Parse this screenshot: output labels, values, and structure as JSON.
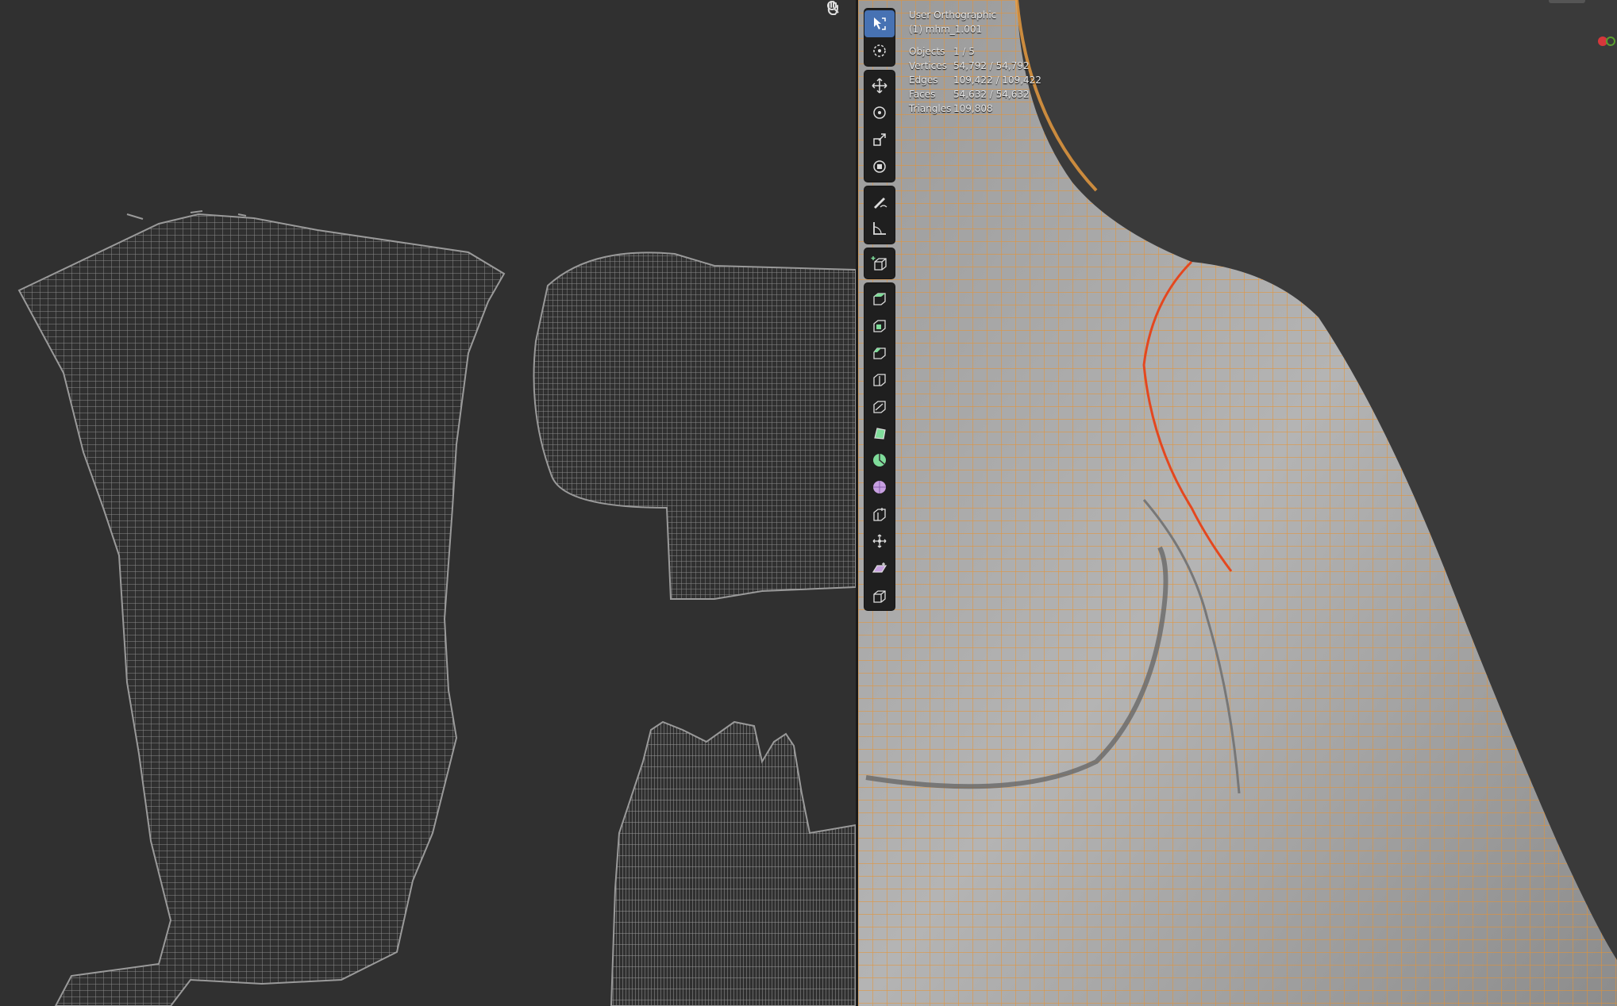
{
  "viewport": {
    "view_name": "User Orthographic",
    "object_name": "(1) mhm_1.001",
    "stats": [
      {
        "label": "Objects",
        "value": "1 / 5"
      },
      {
        "label": "Vertices",
        "value": "54,792 / 54,792"
      },
      {
        "label": "Edges",
        "value": "109,422 / 109,422"
      },
      {
        "label": "Faces",
        "value": "54,632 / 54,632"
      },
      {
        "label": "Triangles",
        "value": "109,808"
      }
    ]
  },
  "toolbar": {
    "tools": [
      {
        "name": "select-box",
        "active": true
      },
      {
        "name": "cursor"
      },
      {
        "name": "move"
      },
      {
        "name": "rotate"
      },
      {
        "name": "scale"
      },
      {
        "name": "transform"
      },
      {
        "name": "annotate"
      },
      {
        "name": "measure"
      },
      {
        "name": "add-cube"
      },
      {
        "name": "extrude-region"
      },
      {
        "name": "inset-faces"
      },
      {
        "name": "bevel"
      },
      {
        "name": "loop-cut"
      },
      {
        "name": "knife"
      },
      {
        "name": "poly-build"
      },
      {
        "name": "spin"
      },
      {
        "name": "smooth"
      },
      {
        "name": "edge-slide"
      },
      {
        "name": "shrink-fatten"
      },
      {
        "name": "shear"
      },
      {
        "name": "rip-region"
      }
    ]
  },
  "uv_editor": {
    "nav_icons": [
      "zoom-icon",
      "pan-hand-icon"
    ]
  },
  "colors": {
    "accent_active": "#4772b3",
    "wire_orange": "#e8922f",
    "seam_red": "#e4471f",
    "uv_wire": "#8a8a8a",
    "gizmo_red": "#d6373b",
    "gizmo_green": "#5a9e2e"
  }
}
